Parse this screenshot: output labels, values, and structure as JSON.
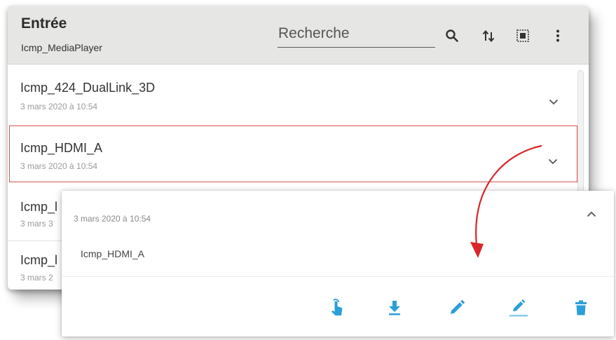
{
  "header": {
    "title": "Entrée",
    "subtitle": "Icmp_MediaPlayer",
    "search_placeholder": "Recherche"
  },
  "icons": {
    "search": "search-icon",
    "sort": "sort-icon",
    "select": "select-all-icon",
    "more": "more-vert-icon"
  },
  "list": {
    "items": [
      {
        "name": "Icmp_424_DualLink_3D",
        "date": "3 mars 2020 à 10:54"
      },
      {
        "name": "Icmp_HDMI_A",
        "date": "3 mars 2020 à 10:54",
        "selected": true
      },
      {
        "name": "Icmp_l",
        "date": "3 mars 3"
      },
      {
        "name": "Icmp_l",
        "date": "3 mars 2"
      }
    ]
  },
  "popup": {
    "date": "3 mars 2020 à 10:54",
    "name": "Icmp_HDMI_A",
    "actions": [
      "touch-icon",
      "download-icon",
      "edit-icon",
      "rename-icon",
      "delete-icon"
    ]
  },
  "colors": {
    "header_bg": "#e6e6e4",
    "accent_blue": "#2a9fd8",
    "selection_red": "#d9534f",
    "arrow_red": "#d8262a"
  }
}
